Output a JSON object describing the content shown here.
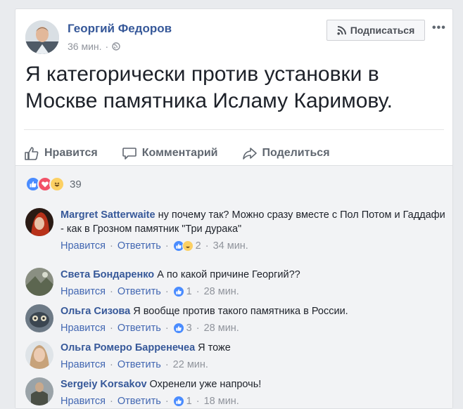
{
  "post": {
    "author": "Георгий Федоров",
    "time": "36 мин.",
    "separator": "·",
    "subscribe_label": "Подписаться",
    "more_label": "•••",
    "text": "Я категорически против установки в Москве памятника Исламу Каримову.",
    "actions": {
      "like": "Нравится",
      "comment": "Комментарий",
      "share": "Поделиться"
    },
    "reactions": {
      "icons": [
        "like-icon",
        "love-icon",
        "haha-icon"
      ],
      "count": "39"
    }
  },
  "comments": [
    {
      "name": "Margret Satterwaite",
      "text": "ну почему так? Можно сразу вместе с Пол Потом и Гаддафи - как в Грозном памятник \"Три дурака\"",
      "like": "Нравится",
      "reply": "Ответить",
      "reaction_count": "2",
      "time": "34 мин."
    },
    {
      "name": "Света Бондаренко",
      "text": "А по какой причине Георгий??",
      "like": "Нравится",
      "reply": "Ответить",
      "reaction_count": "1",
      "time": "28 мин."
    },
    {
      "name": "Ольга Сизова",
      "text": "Я вообще против такого памятника в России.",
      "like": "Нравится",
      "reply": "Ответить",
      "reaction_count": "3",
      "time": "28 мин."
    },
    {
      "name": "Ольга Ромеро Барренечеа",
      "text": "Я тоже",
      "like": "Нравится",
      "reply": "Ответить",
      "time": "22 мин."
    },
    {
      "name": "Sergeiy Korsakov",
      "text": "Охренели уже напрочь!",
      "like": "Нравится",
      "reply": "Ответить",
      "reaction_count": "1",
      "time": "18 мин."
    }
  ],
  "colors": {
    "link": "#365899",
    "like_blue": "#4a8cff",
    "love_red": "#f25268",
    "haha_yellow": "#fcd063",
    "muted": "#90949c"
  }
}
